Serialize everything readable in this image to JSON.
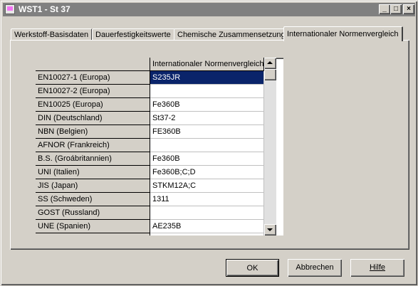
{
  "window": {
    "title": "WST1 - St 37"
  },
  "titlebar_buttons": {
    "minimize": "_",
    "maximize": "□",
    "close": "×"
  },
  "tabs": [
    {
      "label": "Werkstoff-Basisdaten"
    },
    {
      "label": "Dauerfestigkeitswerte"
    },
    {
      "label": "Chemische Zusammensetzung"
    },
    {
      "label": "Internationaler Normenvergleich",
      "active": true
    }
  ],
  "grid": {
    "column_header": "Internationaler Normenvergleich",
    "rows": [
      {
        "standard": "EN10027-1 (Europa)",
        "value": "S235JR",
        "selected": true
      },
      {
        "standard": "EN10027-2 (Europa)",
        "value": ""
      },
      {
        "standard": "EN10025 (Europa)",
        "value": "Fe360B"
      },
      {
        "standard": "DIN (Deutschland)",
        "value": "St37-2"
      },
      {
        "standard": "NBN (Belgien)",
        "value": "FE360B"
      },
      {
        "standard": "AFNOR (Frankreich)",
        "value": ""
      },
      {
        "standard": "B.S. (Groábritannien)",
        "value": "Fe360B"
      },
      {
        "standard": "UNI (Italien)",
        "value": "Fe360B;C;D"
      },
      {
        "standard": "JIS (Japan)",
        "value": "STKM12A;C"
      },
      {
        "standard": "SS (Schweden)",
        "value": "1311"
      },
      {
        "standard": "GOST (Russland)",
        "value": ""
      },
      {
        "standard": "UNE (Spanien)",
        "value": "AE235B"
      },
      {
        "standard": "",
        "value": ""
      }
    ]
  },
  "buttons": {
    "ok": "OK",
    "cancel": "Abbrechen",
    "help": "Hilfe"
  }
}
